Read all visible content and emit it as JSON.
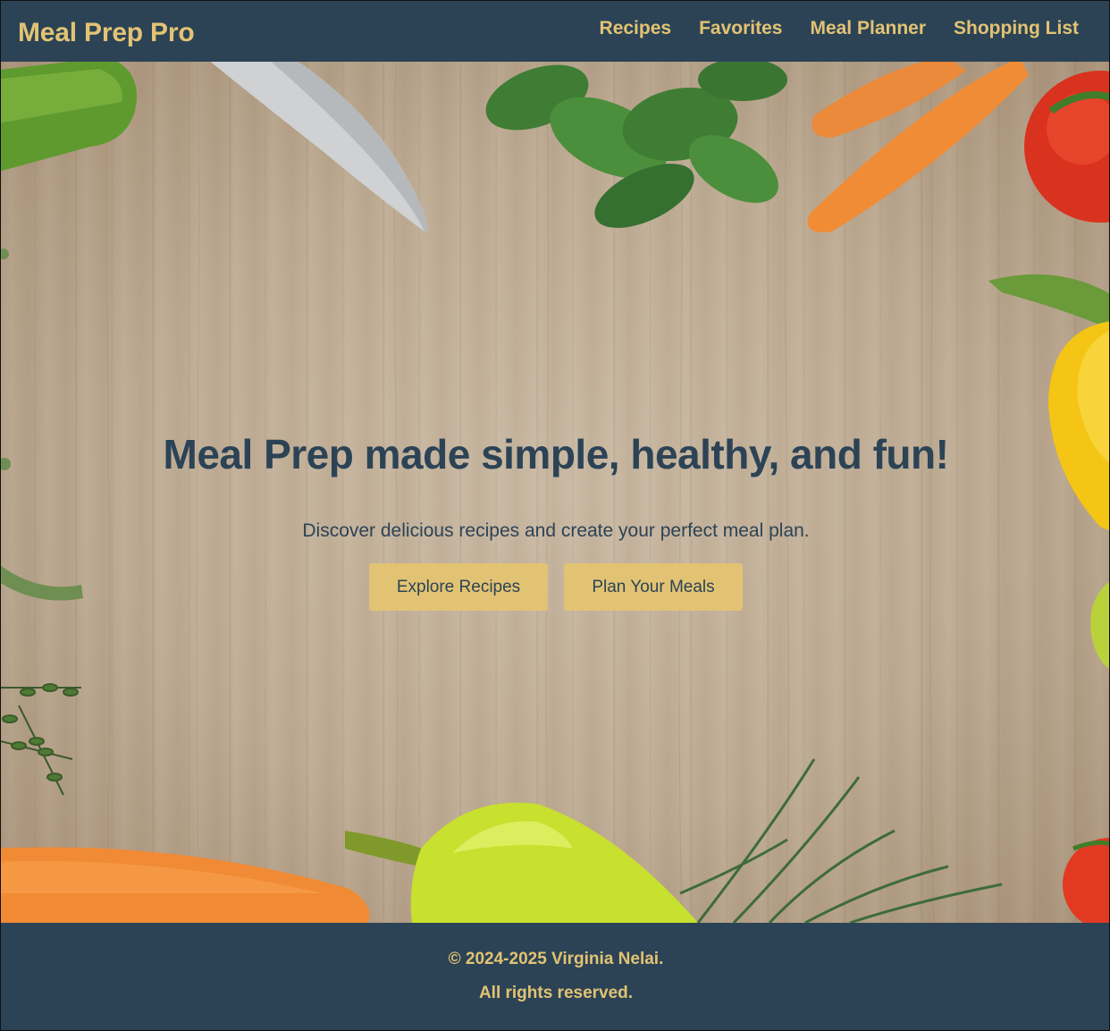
{
  "header": {
    "brand": "Meal Prep Pro",
    "nav": [
      {
        "label": "Recipes"
      },
      {
        "label": "Favorites"
      },
      {
        "label": "Meal Planner"
      },
      {
        "label": "Shopping List"
      }
    ]
  },
  "hero": {
    "title": "Meal Prep made simple, healthy, and fun!",
    "subtitle": "Discover delicious recipes and create your perfect meal plan.",
    "buttons": [
      {
        "label": "Explore Recipes"
      },
      {
        "label": "Plan Your Meals"
      }
    ],
    "background_image": "wooden-board-vegetables"
  },
  "footer": {
    "copyright": "© 2024-2025 Virginia Nelai.",
    "rights": "All rights reserved."
  },
  "colors": {
    "primary_dark": "#2c4356",
    "accent_gold": "#e2c373",
    "wood": "#bdaa92"
  }
}
